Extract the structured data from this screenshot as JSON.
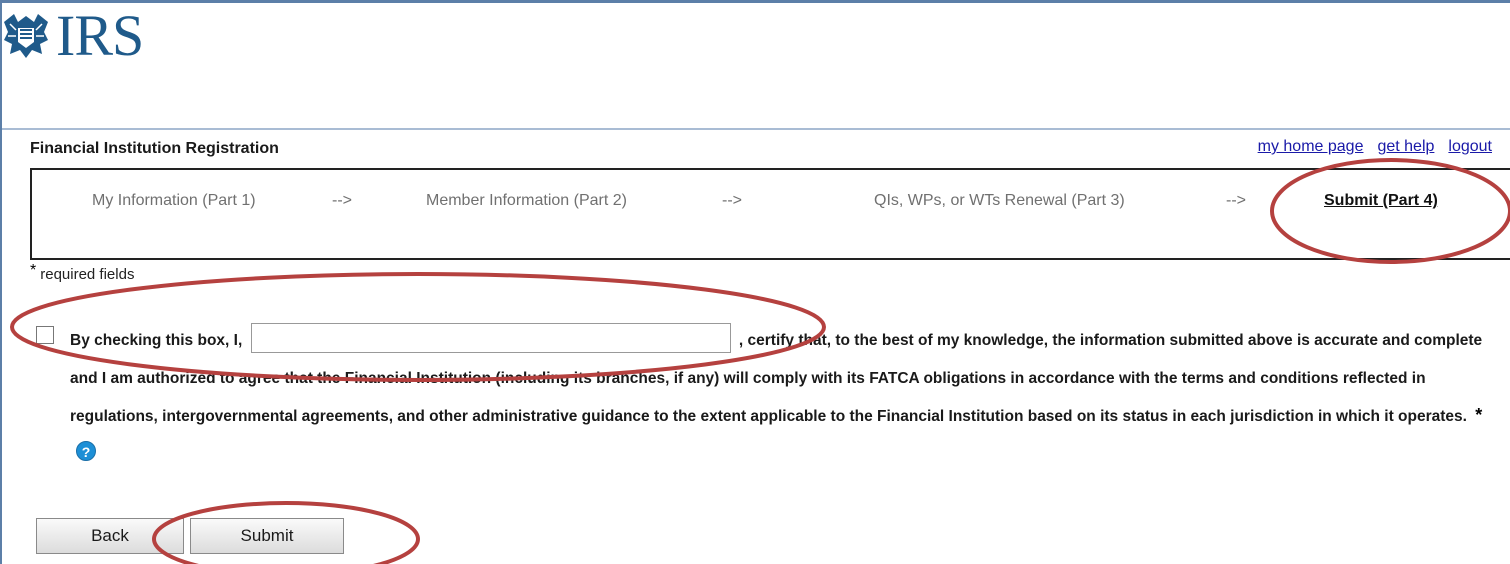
{
  "app": {
    "logo_text": "IRS",
    "logo_icon": "irs-eagle-icon",
    "page_title": "Financial Institution Registration"
  },
  "toplinks": {
    "home": "my home page",
    "help": "get help",
    "logout": "logout"
  },
  "steps": {
    "items": [
      {
        "label": "My Information (Part 1)",
        "current": false
      },
      {
        "label": "Member Information (Part 2)",
        "current": false
      },
      {
        "label": "QIs, WPs, or WTs Renewal (Part 3)",
        "current": false
      },
      {
        "label": "Submit (Part 4)",
        "current": true
      }
    ],
    "arrow": "-->"
  },
  "form": {
    "required_star": "*",
    "required_note": "required fields",
    "cert_prefix": "By checking this box, I,",
    "name_value": "",
    "cert_text": ", certify that, to the best of my knowledge, the information submitted above is accurate and complete and I am authorized to agree that the Financial Institution (including its branches, if any) will comply with its FATCA obligations in accordance with the terms and conditions reflected in regulations, intergovernmental agreements, and other administrative guidance to the extent applicable to the Financial Institution based on its status in each jurisdiction in which it operates.",
    "cert_required_star": "*",
    "help_icon": "question-circle-icon",
    "checkbox_checked": false
  },
  "buttons": {
    "back": "Back",
    "submit": "Submit"
  },
  "colors": {
    "annotation_red": "#b5413f",
    "link_blue": "#1a1aa8",
    "brand_blue": "#1f5a8a",
    "help_blue": "#1d8fd6"
  }
}
